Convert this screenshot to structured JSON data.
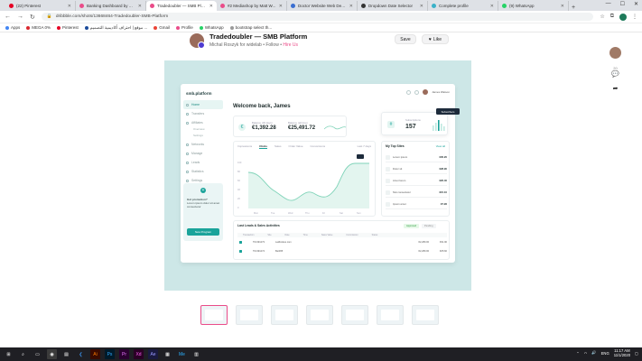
{
  "browser": {
    "tabs": [
      {
        "title": "(22) Pinterest",
        "color": "#e60023"
      },
      {
        "title": "Banking Dashboard by Afro",
        "color": "#ea4c89"
      },
      {
        "title": "Tradedoubler — SMB Platfo",
        "color": "#ea4c89",
        "active": true
      },
      {
        "title": "#2 Mediashop by Matt W...",
        "color": "#ea4c89"
      },
      {
        "title": "Doctor Website Web Desig",
        "color": "#3b6fd1"
      },
      {
        "title": "Dropdown Date Selector",
        "color": "#333333"
      },
      {
        "title": "Complete profile",
        "color": "#3ab1c8"
      },
      {
        "title": "(9) WhatsApp",
        "color": "#25d366"
      }
    ],
    "new_tab": "+",
    "url": "dribbble.com/shots/13668464-Tradedoubler-SMB-Platform",
    "bookmarks": [
      {
        "label": "Apps",
        "color": "#4285f4"
      },
      {
        "label": "MEGA 0%",
        "color": "#d9272e"
      },
      {
        "label": "Pinterest",
        "color": "#e60023"
      },
      {
        "label": "موقع | احتراف أكاديمية التصميم ...",
        "color": "#1a4a9a"
      },
      {
        "label": "Gmail",
        "color": "#ea4335"
      },
      {
        "label": "Profile",
        "color": "#ea4c89"
      },
      {
        "label": "WhatsApp",
        "color": "#25d366"
      },
      {
        "label": "bootstrap select th...",
        "color": "#999999"
      }
    ]
  },
  "shot": {
    "title": "Tradedoubler — SMB Platform",
    "author": "Michal Roszyk",
    "for_word": "for",
    "team": "widelab",
    "follow": "Follow",
    "hire": "Hire Us",
    "save_label": "Save",
    "like_label": "Like",
    "comments_count": "20"
  },
  "dashboard": {
    "logo": "smb.platform",
    "nav": [
      "Home",
      "Transfers",
      "Affiliates",
      "Networks",
      "Manage",
      "Leads",
      "Statistics",
      "Settings"
    ],
    "subnav": [
      "Overview",
      "Settings"
    ],
    "promo_title": "Got promotion?",
    "promo_text": "Lorem ipsum dolor sit amet consectetur",
    "promo_button": "New Program",
    "user": "James Watson",
    "welcome": "Welcome back, James",
    "balance1_label": "Balance (30 days)",
    "balance1_value": "€1,392.28",
    "balance2_label": "Balance (all time)",
    "balance2_value": "€25,491.72",
    "savings_label": "Subscriptions",
    "savings_value": "157",
    "tooltip": "Subscribers",
    "chart_tabs": [
      "Impressions",
      "Clicks",
      "Sales",
      "Order Value",
      "Conversions"
    ],
    "chart_period": "Last 7 days",
    "chart_y": [
      "100",
      "80",
      "60",
      "40",
      "20",
      "0"
    ],
    "chart_x": [
      "Mon",
      "Tue",
      "Wed",
      "Thu",
      "Fri",
      "Sat",
      "Sun"
    ],
    "top_title": "My Top Sites",
    "top_more": "View all",
    "top_rows": [
      {
        "name": "Lorem ipsum",
        "val": "€35.20"
      },
      {
        "name": "Dolor sit",
        "val": "€28.90"
      },
      {
        "name": "Amet lorem",
        "val": "€20.40"
      },
      {
        "name": "Nisi consectetur",
        "val": "€15.10"
      },
      {
        "name": "Ipsum amet",
        "val": "€7.90"
      }
    ],
    "trades_title": "Last Leads & Sales Activities",
    "trades_badge1": "Approved",
    "trades_badge2": "Pending",
    "trades_cols": [
      "Transaction",
      "Site",
      "Date",
      "Time",
      "Sales Value",
      "Commission",
      "Status"
    ],
    "trades_rows": [
      {
        "id": "TR-091273",
        "site": "Ladbrokes.com",
        "val": "€2,280.00",
        "com": "€31.90"
      },
      {
        "id": "TR-091274",
        "site": "Bet365",
        "val": "€2,280.00",
        "com": "€25.60"
      }
    ]
  },
  "taskbar": {
    "lang": "ENG",
    "time": "11:17 AM",
    "date": "11/1/2020"
  }
}
